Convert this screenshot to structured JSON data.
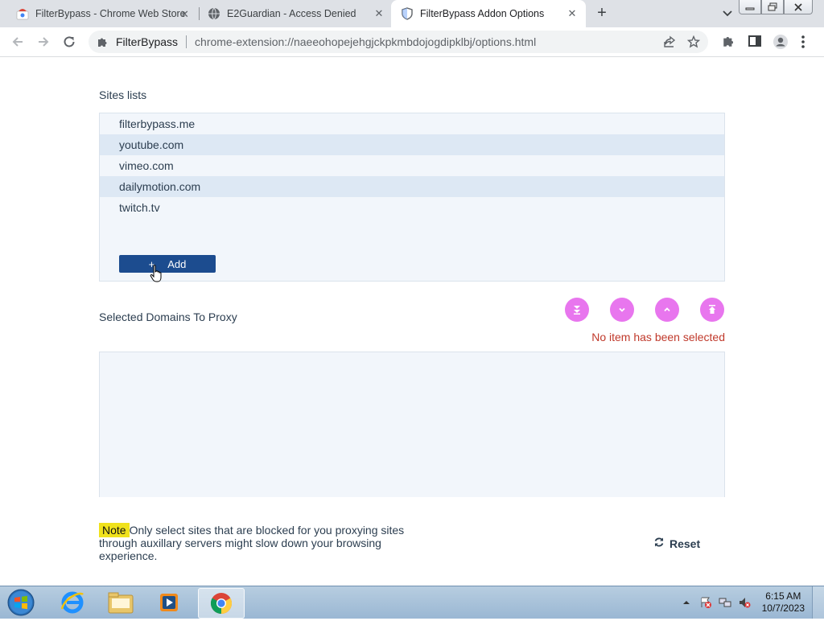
{
  "browser": {
    "tabs": [
      {
        "title": "FilterBypass - Chrome Web Store",
        "icon": "chrome-web-store-icon"
      },
      {
        "title": "E2Guardian - Access Denied",
        "icon": "globe-icon"
      },
      {
        "title": "FilterBypass Addon Options",
        "icon": "shield-icon",
        "active": true
      }
    ],
    "omnibox": {
      "extension_name": "FilterBypass",
      "url": "chrome-extension://naeeohopejehgjckpkmbdojogdipklbj/options.html"
    }
  },
  "page": {
    "sites_label": "Sites lists",
    "sites": [
      "filterbypass.me",
      "youtube.com",
      "vimeo.com",
      "dailymotion.com",
      "twitch.tv"
    ],
    "add_label": "Add",
    "add_symbol": "+",
    "selected_label": "Selected Domains To Proxy",
    "status_message": "No item has been selected",
    "note_badge": "Note",
    "note_text": "Only select sites that are blocked for you proxying sites through auxillary servers might slow down your browsing experience.",
    "reset_label": "Reset",
    "move_buttons": [
      "move-bottom-icon",
      "move-down-icon",
      "move-up-icon",
      "move-top-icon"
    ]
  },
  "taskbar": {
    "time": "6:15 AM",
    "date": "10/7/2023",
    "apps": [
      "internet-explorer-icon",
      "file-explorer-icon",
      "media-player-icon",
      "chrome-icon"
    ]
  },
  "colors": {
    "add_button": "#1c4c8f",
    "move_buttons": "#e876ee",
    "status_message": "#c0392b",
    "note_badge": "#f0e21c"
  }
}
